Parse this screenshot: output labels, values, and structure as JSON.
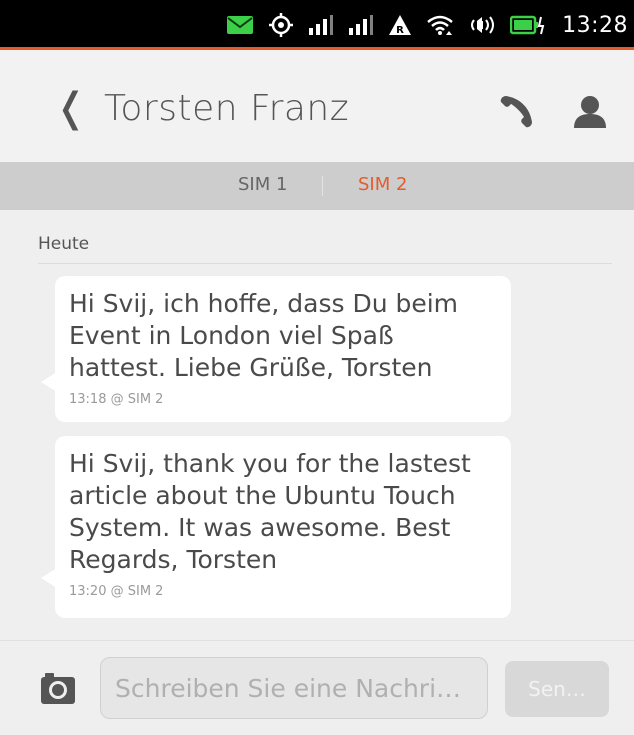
{
  "status_bar": {
    "time": "13:28",
    "icons": [
      "message-icon",
      "location-icon",
      "signal-sim1-icon",
      "signal-sim2-icon",
      "roaming-icon",
      "wifi-icon",
      "volume-icon",
      "battery-charging-icon"
    ],
    "message_icon_color": "#3bd047"
  },
  "header": {
    "back_glyph": "❬",
    "contact_name": "Torsten Franz"
  },
  "sim_tabs": [
    {
      "label": "SIM 1",
      "selected": false
    },
    {
      "label": "SIM 2",
      "selected": true
    }
  ],
  "colors": {
    "accent": "#e55b2b",
    "bubble_bg": "#ffffff",
    "background": "#efefef"
  },
  "conversation": {
    "day_label": "Heute",
    "messages": [
      {
        "text": "Hi Svij, ich hoffe, dass Du beim Event in London viel Spaß hattest. Liebe Grüße, Torsten",
        "meta": "13:18 @ SIM 2"
      },
      {
        "text": "Hi Svij, thank you for the lastest article about the Ubuntu Touch System. It was awesome. Best Regards, Torsten",
        "meta": "13:20 @ SIM 2"
      }
    ]
  },
  "composer": {
    "placeholder": "Schreiben Sie eine Nachri…",
    "send_label": "Sen…"
  }
}
